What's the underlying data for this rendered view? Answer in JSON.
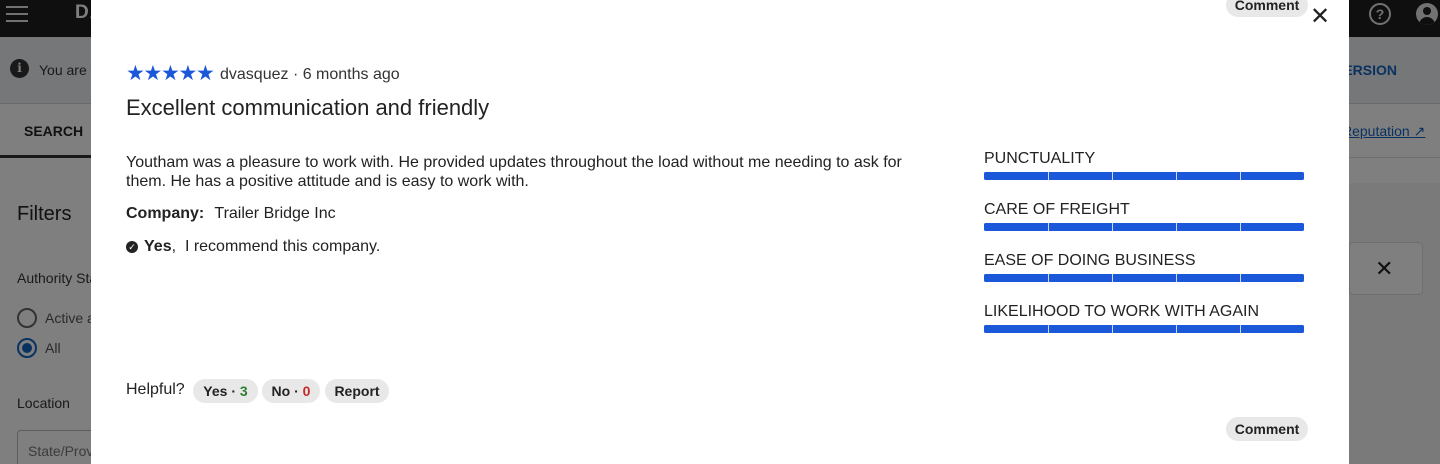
{
  "app": {
    "brand": "DA",
    "info_text": "You are v",
    "classic_link": "C VERSION",
    "tab_search": "SEARCH",
    "reputation_link": "Reputation",
    "filters_title": "Filters",
    "authority_label": "Authority Sta",
    "radio_active": "Active a",
    "radio_all": "All",
    "location_label": "Location",
    "state_placeholder": "State/Prov"
  },
  "modal": {
    "comment_top": "Comment",
    "comment_bottom": "Comment",
    "review": {
      "stars": 5,
      "star_color": "#1a57d9",
      "author_line": "dvasquez · 6 months ago",
      "title": "Excellent communication and friendly",
      "body": "Youtham was a pleasure to work with. He provided updates throughout the load without me needing to ask for them. He has a positive attitude and is easy to work with.",
      "company_label": "Company:",
      "company_name": "Trailer Bridge Inc",
      "recommend_yes": "Yes",
      "recommend_text": "I recommend this company."
    },
    "ratings": [
      {
        "label": "PUNCTUALITY",
        "value": 5,
        "max": 5
      },
      {
        "label": "CARE OF FREIGHT",
        "value": 5,
        "max": 5
      },
      {
        "label": "EASE OF DOING BUSINESS",
        "value": 5,
        "max": 5
      },
      {
        "label": "LIKELIHOOD TO WORK WITH AGAIN",
        "value": 5,
        "max": 5
      }
    ],
    "helpful": {
      "label": "Helpful?",
      "yes_label": "Yes",
      "yes_count": "3",
      "no_label": "No",
      "no_count": "0",
      "report": "Report"
    }
  }
}
